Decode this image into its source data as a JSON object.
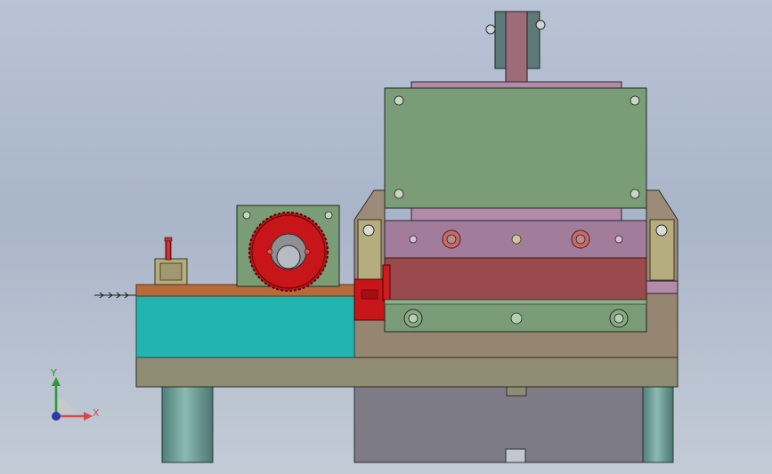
{
  "colors": {
    "background_top": "#b9c3d6",
    "background_bottom": "#c3cbd6",
    "base_frame": "#8e8c72",
    "cyan_block": "#22b5b0",
    "copper_strip": "#b86b3a",
    "gear_red": "#c8151a",
    "green_plate": "#7a9c76",
    "mauve_plate": "#a27d9b",
    "maroon_block": "#9a4a4c",
    "gray_lower": "#7d7b85",
    "column": "#6c9d98"
  },
  "triad": {
    "x_label": "X",
    "y_label": "Y",
    "icon": "coordinate-triad-icon"
  }
}
